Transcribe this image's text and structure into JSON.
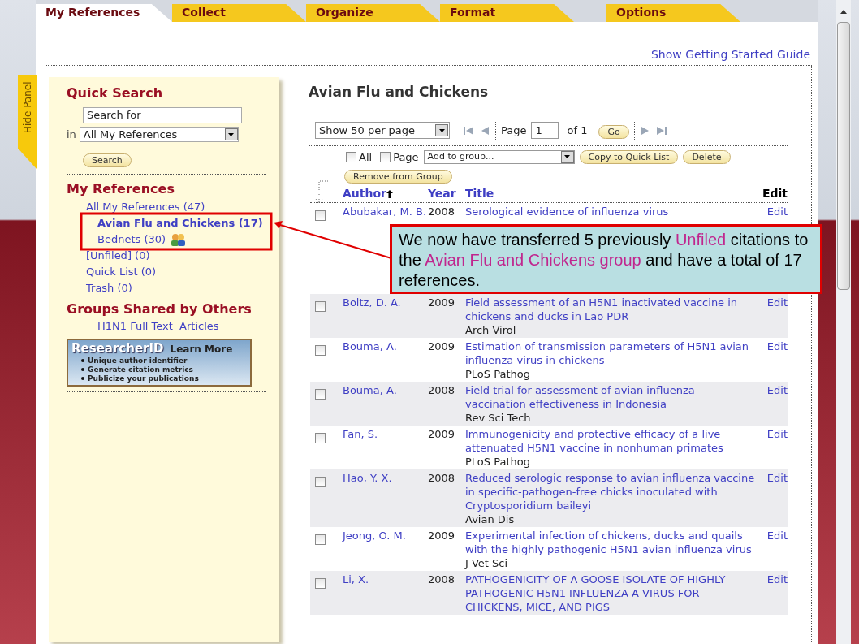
{
  "tabs": [
    {
      "label": "My References",
      "selected": true
    },
    {
      "label": "Collect",
      "selected": false
    },
    {
      "label": "Organize",
      "selected": false
    },
    {
      "label": "Format",
      "selected": false
    },
    {
      "label": "Options",
      "selected": false
    }
  ],
  "guide_link": "Show Getting Started Guide",
  "hide_panel": "Hide Panel",
  "sidebar": {
    "quick_search": {
      "title": "Quick Search",
      "placeholder": "Search for",
      "in_label": "in",
      "scope": "All My References",
      "button": "Search"
    },
    "my_references": {
      "title": "My References",
      "items": [
        {
          "label": "All My References (47)",
          "selected": false,
          "shared": false,
          "children": [
            {
              "label": "Avian Flu and Chickens (17)",
              "selected": true,
              "shared": false
            },
            {
              "label": "Bednets (30)",
              "selected": false,
              "shared": true
            }
          ]
        },
        {
          "label": "[Unfiled] (0)",
          "selected": false,
          "shared": false
        },
        {
          "label": "Quick List (0)",
          "selected": false,
          "shared": false
        },
        {
          "label": "Trash (0)",
          "selected": false,
          "shared": false
        }
      ]
    },
    "groups_shared": {
      "title": "Groups Shared by Others",
      "items": [
        "H1N1 Full Text  Articles"
      ]
    },
    "banner": {
      "brand": "ResearcherID",
      "link": "Learn More",
      "bullets": [
        "Unique author identifier",
        "Generate citation metrics",
        "Publicize your publications"
      ]
    }
  },
  "main": {
    "title": "Avian Flu and Chickens",
    "page_size": "Show 50 per page",
    "page_label": "Page",
    "page_value": "1",
    "page_of": "of 1",
    "go": "Go",
    "select_all": {
      "label": "All",
      "checked": false
    },
    "select_page": {
      "label": "Page",
      "checked": false
    },
    "add_to_group": "Add to group...",
    "buttons": [
      "Copy to Quick List",
      "Delete",
      "Remove from Group"
    ],
    "columns": [
      {
        "label": "Author",
        "sorted": true
      },
      {
        "label": "Year",
        "sorted": false
      },
      {
        "label": "Title",
        "sorted": false
      },
      {
        "label": "Edit",
        "sorted": false
      }
    ],
    "rows": [
      {
        "author": "Abubakar, M. B.",
        "year": "2008",
        "title": "Serological evidence of influenza virus",
        "edit": "Edit",
        "checked": false
      },
      {
        "author": "Boltz, D. A.",
        "year": "2009",
        "title": "Field assessment of an H5N1 inactivated vaccine in chickens and ducks in Lao PDR",
        "journal": "Arch Virol",
        "edit": "Edit",
        "checked": false
      },
      {
        "author": "Bouma, A.",
        "year": "2009",
        "title": "Estimation of transmission parameters of H5N1 avian influenza virus in chickens",
        "journal": "PLoS Pathog",
        "edit": "Edit",
        "checked": false
      },
      {
        "author": "Bouma, A.",
        "year": "2008",
        "title": "Field trial for assessment of avian influenza vaccination effectiveness in Indonesia",
        "journal": "Rev Sci Tech",
        "edit": "Edit",
        "checked": false
      },
      {
        "author": "Fan, S.",
        "year": "2009",
        "title": "Immunogenicity and protective efficacy of a live attenuated H5N1 vaccine in nonhuman primates",
        "journal": "PLoS Pathog",
        "edit": "Edit",
        "checked": false
      },
      {
        "author": "Hao, Y. X.",
        "year": "2008",
        "title": "Reduced serologic response to avian influenza vaccine in specific-pathogen-free chicks inoculated with Cryptosporidium baileyi",
        "journal": "Avian Dis",
        "edit": "Edit",
        "checked": false
      },
      {
        "author": "Jeong, O. M.",
        "year": "2009",
        "title": "Experimental infection of chickens, ducks and quails with the highly pathogenic H5N1 avian influenza virus",
        "journal": "J Vet Sci",
        "edit": "Edit",
        "checked": false
      },
      {
        "author": "Li, X.",
        "year": "2008",
        "title": "PATHOGENICITY OF A GOOSE ISOLATE OF HIGHLY PATHOGENIC H5N1 INFLUENZA A VIRUS FOR CHICKENS, MICE, AND PIGS",
        "edit": "Edit",
        "checked": false
      }
    ]
  },
  "callout": {
    "segments": [
      {
        "text": "We now have transferred 5 previously ",
        "highlight": false
      },
      {
        "text": "Unfiled",
        "highlight": true
      },
      {
        "text": " citations to the ",
        "highlight": false
      },
      {
        "text": "Avian Flu and Chickens group",
        "highlight": true
      },
      {
        "text": " and have a total of 17 references.",
        "highlight": false
      }
    ]
  }
}
